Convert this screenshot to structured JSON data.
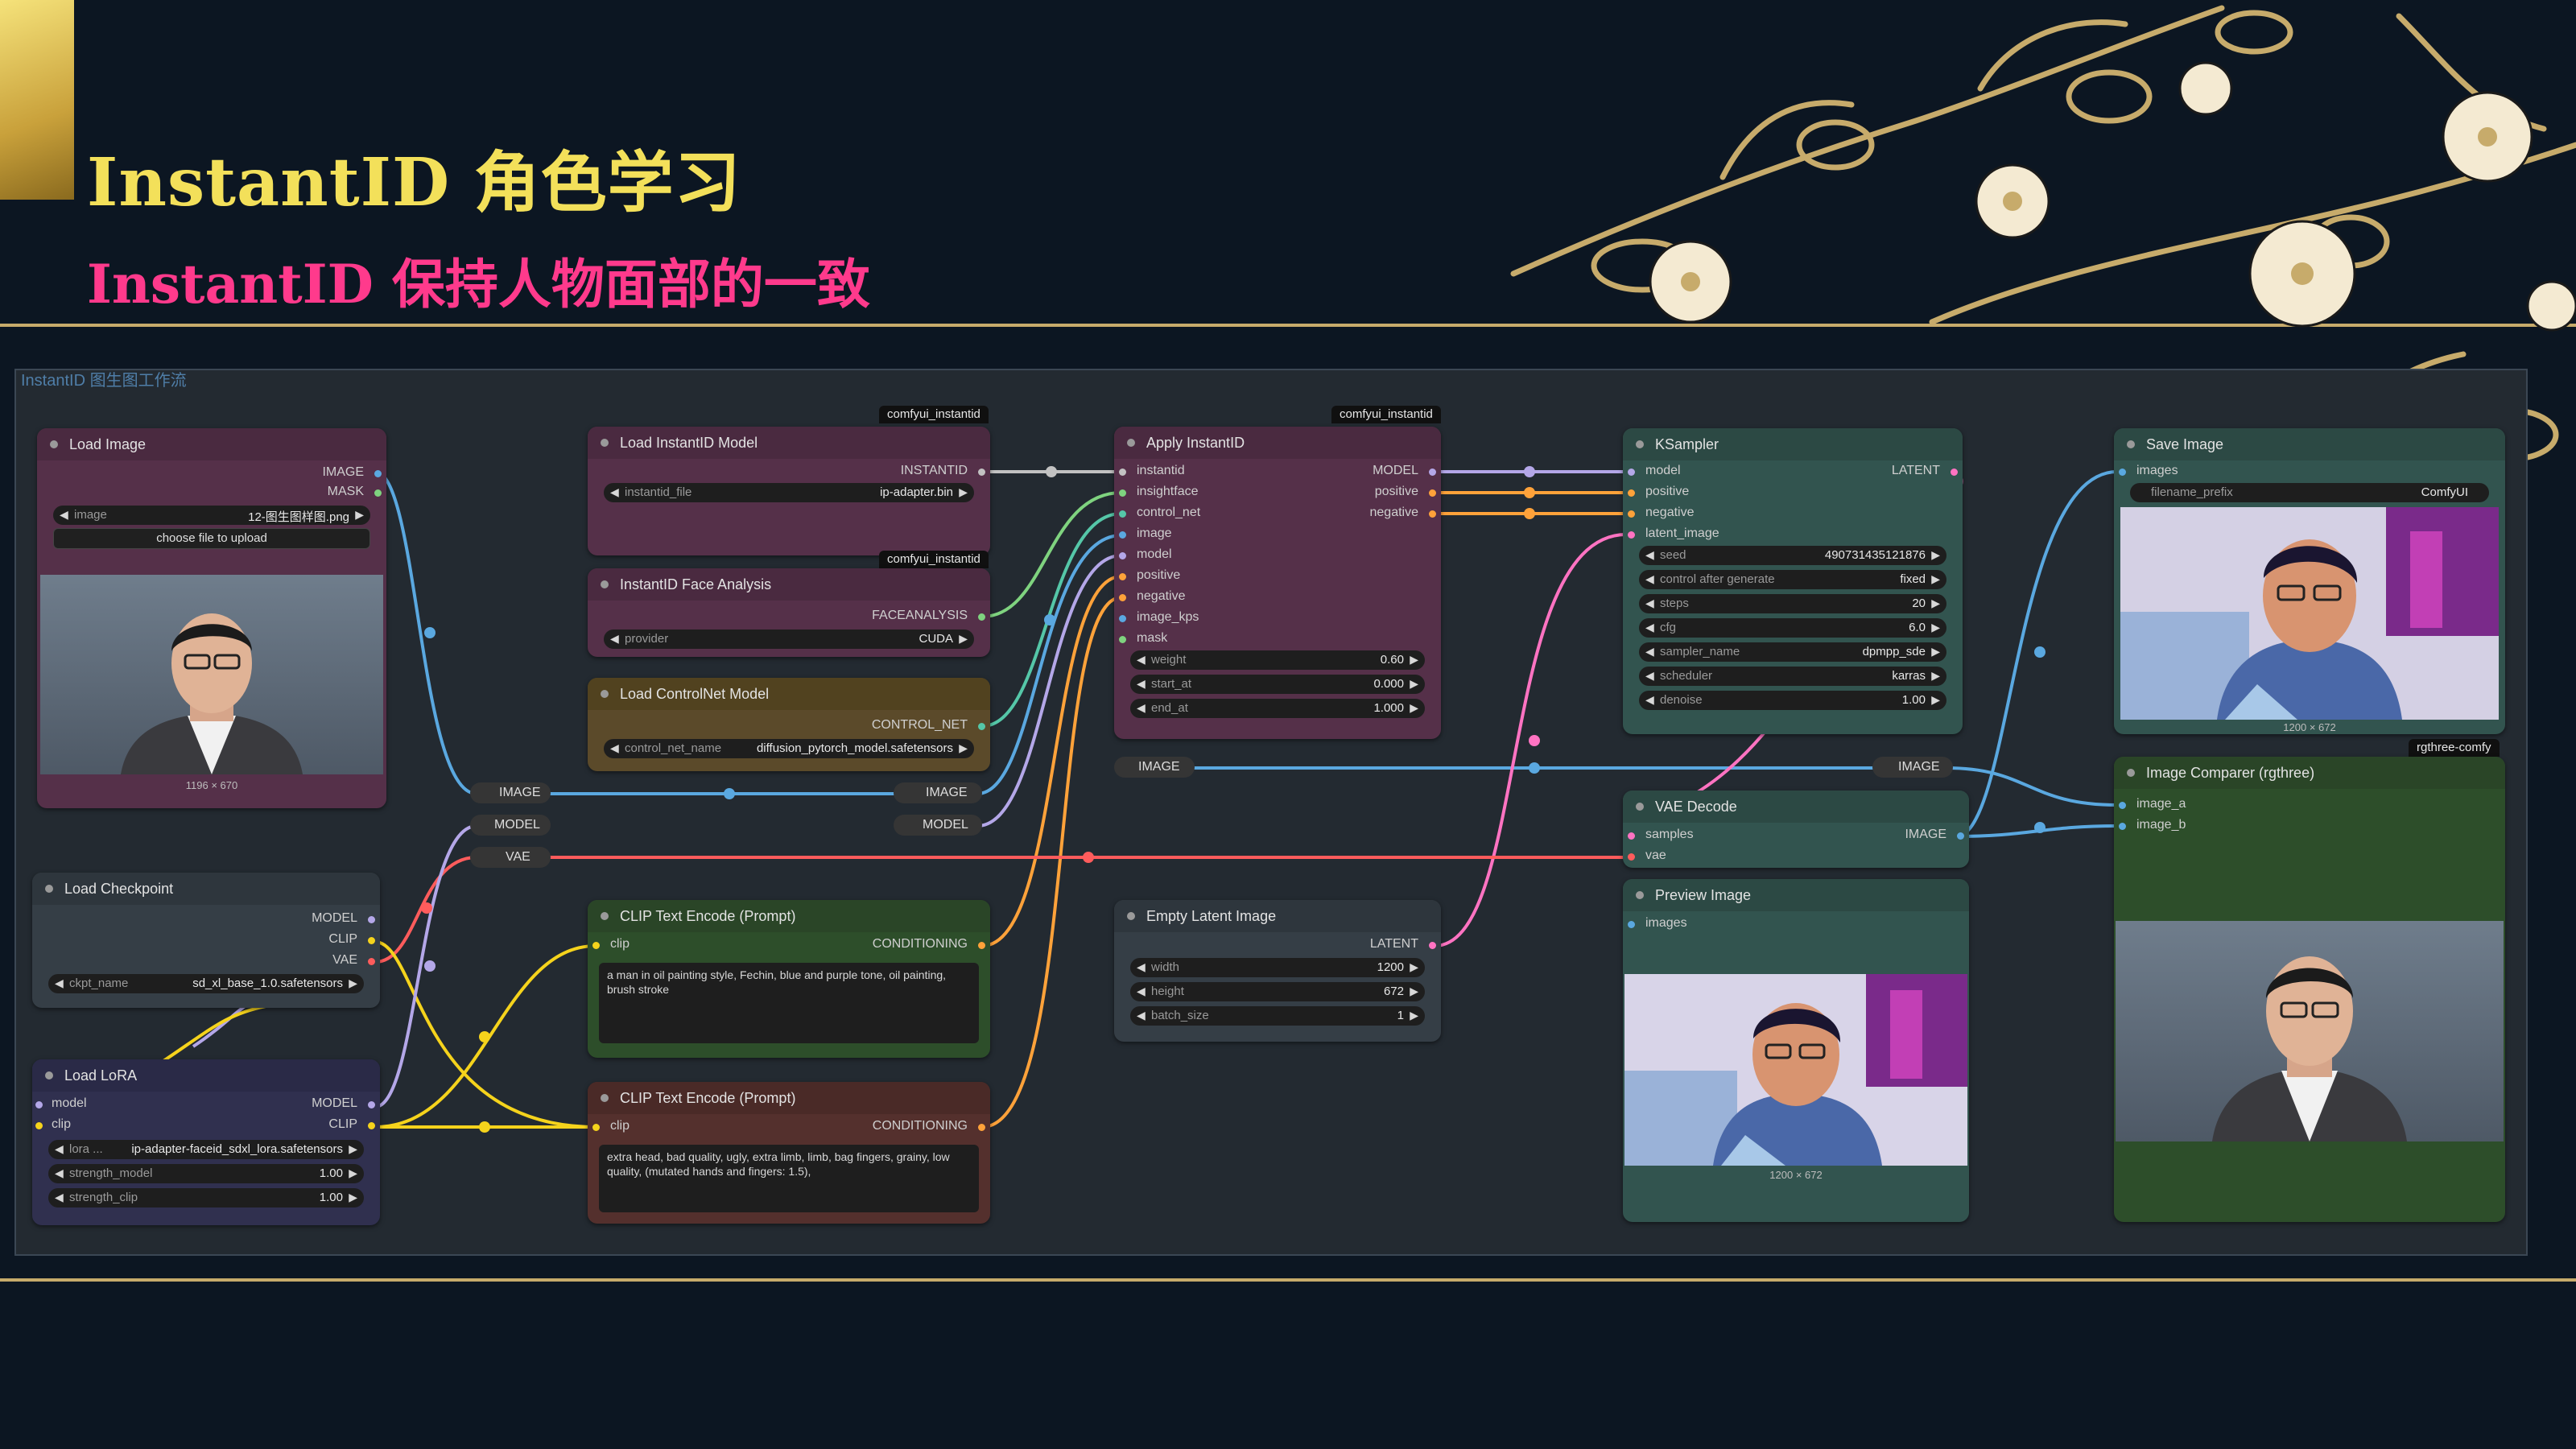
{
  "slide": {
    "title": "InstantID 角色学习",
    "subtitle": "InstantID 保持人物面部的一致",
    "group_label": "InstantID 图生图工作流"
  },
  "colors": {
    "accent_gold": "#f3e05a",
    "accent_pink": "#ff3a8c",
    "background": "#0c1622",
    "canvas": "#232a31"
  },
  "nodes": {
    "load_image": {
      "title": "Load Image",
      "out1": "IMAGE",
      "out2": "MASK",
      "w_label": "image",
      "w_value": "12-图生图样图.png",
      "button": "choose file to upload",
      "caption": "1196 × 670"
    },
    "load_instantid_model": {
      "title": "Load InstantID Model",
      "badge": "comfyui_instantid",
      "out": "INSTANTID",
      "w_label": "instantid_file",
      "w_value": "ip-adapter.bin"
    },
    "face_analysis": {
      "title": "InstantID Face Analysis",
      "badge": "comfyui_instantid",
      "out": "FACEANALYSIS",
      "w_label": "provider",
      "w_value": "CUDA"
    },
    "load_controlnet": {
      "title": "Load ControlNet Model",
      "out": "CONTROL_NET",
      "w_label": "control_net_name",
      "w_value": "diffusion_pytorch_model.safetensors"
    },
    "apply_instantid": {
      "title": "Apply InstantID",
      "badge": "comfyui_instantid",
      "inputs": [
        "instantid",
        "insightface",
        "control_net",
        "image",
        "model",
        "positive",
        "negative",
        "image_kps",
        "mask"
      ],
      "outputs": [
        "MODEL",
        "positive",
        "negative"
      ],
      "widgets": [
        {
          "label": "weight",
          "value": "0.60"
        },
        {
          "label": "start_at",
          "value": "0.000"
        },
        {
          "label": "end_at",
          "value": "1.000"
        }
      ]
    },
    "ksampler": {
      "title": "KSampler",
      "inputs": [
        "model",
        "positive",
        "negative",
        "latent_image"
      ],
      "out": "LATENT",
      "widgets": [
        {
          "label": "seed",
          "value": "490731435121876"
        },
        {
          "label": "control after generate",
          "value": "fixed"
        },
        {
          "label": "steps",
          "value": "20"
        },
        {
          "label": "cfg",
          "value": "6.0"
        },
        {
          "label": "sampler_name",
          "value": "dpmpp_sde"
        },
        {
          "label": "scheduler",
          "value": "karras"
        },
        {
          "label": "denoise",
          "value": "1.00"
        }
      ]
    },
    "save_image": {
      "title": "Save Image",
      "in": "images",
      "w_label": "filename_prefix",
      "w_value": "ComfyUI",
      "caption": "1200 × 672"
    },
    "image_comparer": {
      "title": "Image Comparer (rgthree)",
      "badge": "rgthree-comfy",
      "in1": "image_a",
      "in2": "image_b"
    },
    "vae_decode": {
      "title": "VAE Decode",
      "in1": "samples",
      "in2": "vae",
      "out": "IMAGE"
    },
    "preview_image": {
      "title": "Preview Image",
      "in": "images",
      "caption": "1200 × 672"
    },
    "load_checkpoint": {
      "title": "Load Checkpoint",
      "outputs": [
        "MODEL",
        "CLIP",
        "VAE"
      ],
      "w_label": "ckpt_name",
      "w_value": "sd_xl_base_1.0.safetensors"
    },
    "load_lora": {
      "title": "Load LoRA",
      "in1": "model",
      "in2": "clip",
      "out1": "MODEL",
      "out2": "CLIP",
      "widgets": [
        {
          "label": "lora ...",
          "value": "ip-adapter-faceid_sdxl_lora.safetensors"
        },
        {
          "label": "strength_model",
          "value": "1.00"
        },
        {
          "label": "strength_clip",
          "value": "1.00"
        }
      ]
    },
    "clip_pos": {
      "title": "CLIP Text Encode (Prompt)",
      "in": "clip",
      "out": "CONDITIONING",
      "text": "a man in oil painting style, Fechin, blue and purple tone, oil painting, brush stroke"
    },
    "clip_neg": {
      "title": "CLIP Text Encode (Prompt)",
      "in": "clip",
      "out": "CONDITIONING",
      "text": "extra head, bad quality, ugly, extra limb, limb, bag fingers, grainy, low quality, (mutated hands and fingers: 1.5),"
    },
    "empty_latent": {
      "title": "Empty Latent Image",
      "out": "LATENT",
      "widgets": [
        {
          "label": "width",
          "value": "1200"
        },
        {
          "label": "height",
          "value": "672"
        },
        {
          "label": "batch_size",
          "value": "1"
        }
      ]
    }
  },
  "reroutes": {
    "image_a": "IMAGE",
    "model_a": "MODEL",
    "vae": "VAE",
    "image_b": "IMAGE",
    "model_b": "MODEL",
    "image_c": "IMAGE",
    "image_d": "IMAGE"
  }
}
